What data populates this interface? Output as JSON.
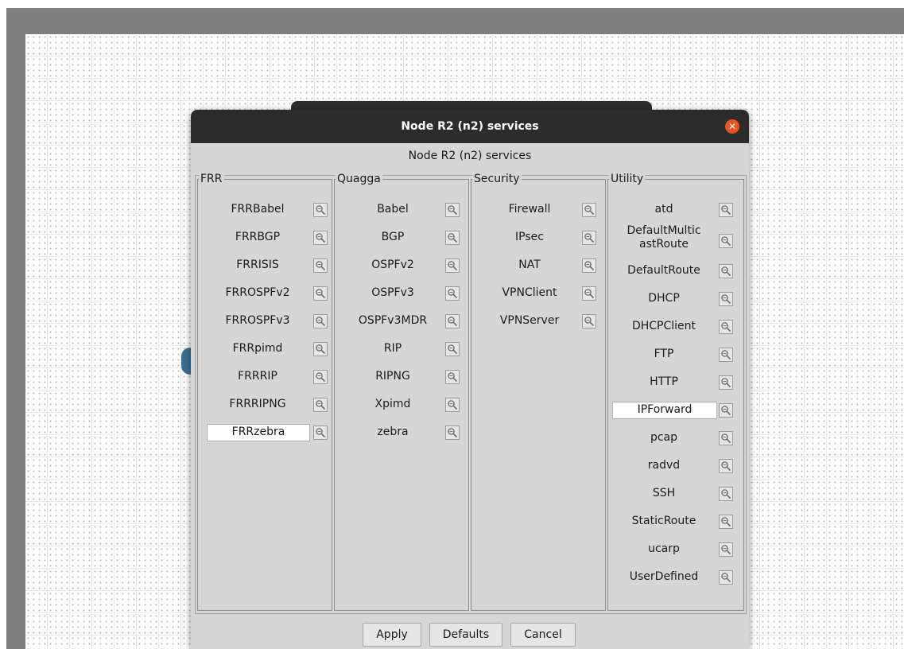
{
  "dialog": {
    "window_title": "Node R2 (n2) services",
    "subtitle": "Node R2 (n2) services",
    "close_icon": "close-icon"
  },
  "columns": [
    {
      "name": "FRR",
      "items": [
        {
          "label": "FRRBabel"
        },
        {
          "label": "FRRBGP"
        },
        {
          "label": "FRRISIS"
        },
        {
          "label": "FRROSPFv2"
        },
        {
          "label": "FRROSPFv3"
        },
        {
          "label": "FRRpimd"
        },
        {
          "label": "FRRRIP"
        },
        {
          "label": "FRRRIPNG"
        },
        {
          "label": "FRRzebra",
          "selected": true
        }
      ]
    },
    {
      "name": "Quagga",
      "items": [
        {
          "label": "Babel"
        },
        {
          "label": "BGP"
        },
        {
          "label": "OSPFv2"
        },
        {
          "label": "OSPFv3"
        },
        {
          "label": "OSPFv3MDR"
        },
        {
          "label": "RIP"
        },
        {
          "label": "RIPNG"
        },
        {
          "label": "Xpimd"
        },
        {
          "label": "zebra"
        }
      ]
    },
    {
      "name": "Security",
      "items": [
        {
          "label": "Firewall"
        },
        {
          "label": "IPsec"
        },
        {
          "label": "NAT"
        },
        {
          "label": "VPNClient"
        },
        {
          "label": "VPNServer"
        }
      ]
    },
    {
      "name": "Utility",
      "items": [
        {
          "label": "atd"
        },
        {
          "label": "DefaultMultic\nastRoute"
        },
        {
          "label": "DefaultRoute"
        },
        {
          "label": "DHCP"
        },
        {
          "label": "DHCPClient"
        },
        {
          "label": "FTP"
        },
        {
          "label": "HTTP"
        },
        {
          "label": "IPForward",
          "selected": true
        },
        {
          "label": "pcap"
        },
        {
          "label": "radvd"
        },
        {
          "label": "SSH"
        },
        {
          "label": "StaticRoute"
        },
        {
          "label": "ucarp"
        },
        {
          "label": "UserDefined"
        }
      ]
    }
  ],
  "buttons": {
    "apply": "Apply",
    "defaults": "Defaults",
    "cancel": "Cancel"
  },
  "icons": {
    "config": "wrench-config-icon"
  },
  "colors": {
    "titlebar": "#2c2c2c",
    "close": "#e95420",
    "dialog_bg": "#d6d6d6"
  }
}
